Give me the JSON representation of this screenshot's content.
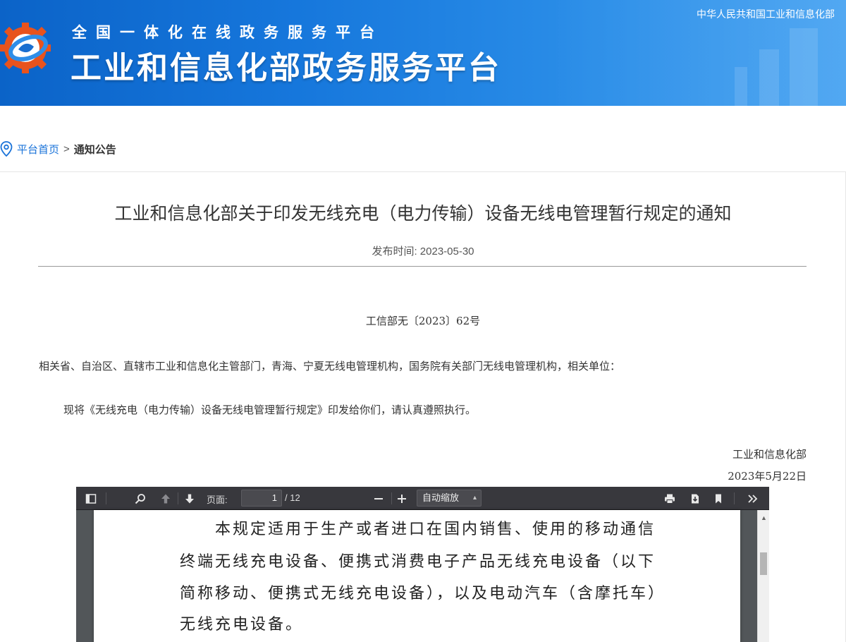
{
  "header": {
    "subtitle": "全国一体化在线政务服务平台",
    "title": "工业和信息化部政务服务平台",
    "ministry_link": "中华人民共和国工业和信息化部",
    "logo_colors": {
      "gear": "#e8531d",
      "ring": "#2e8ee8"
    }
  },
  "breadcrumb": {
    "home": "平台首页",
    "separator": ">",
    "current": "通知公告"
  },
  "article": {
    "title": "工业和信息化部关于印发无线充电（电力传输）设备无线电管理暂行规定的通知",
    "publish_label": "发布时间:",
    "publish_date": "2023-05-30",
    "doc_number": "工信部无〔2023〕62号",
    "addressee": "相关省、自治区、直辖市工业和信息化主管部门，青海、宁夏无线电管理机构，国务院有关部门无线电管理机构，相关单位：",
    "body": "现将《无线充电（电力传输）设备无线电管理暂行规定》印发给你们，请认真遵照执行。",
    "signature_org": "工业和信息化部",
    "signature_date": "2023年5月22日"
  },
  "pdf_viewer": {
    "page_label": "页面:",
    "current_page": "1",
    "total_pages": "/ 12",
    "zoom": "自动缩放",
    "icons": [
      "sidebar-toggle-icon",
      "search-icon",
      "arrow-up-icon",
      "arrow-down-icon",
      "zoom-out-icon",
      "zoom-in-icon",
      "print-icon",
      "download-icon",
      "bookmark-icon",
      "more-tools-icon"
    ],
    "page_lines": [
      "本规定适用于生产或者进口在国内销售、使用的移动通信",
      "终端无线充电设备、便携式消费电子产品无线充电设备（以下",
      "简称移动、便携式无线充电设备），以及电动汽车（含摩托车）",
      "无线充电设备。"
    ]
  },
  "colors": {
    "header_blue": "#1677dc",
    "link_blue": "#1a73d9",
    "toolbar": "#38383d"
  }
}
